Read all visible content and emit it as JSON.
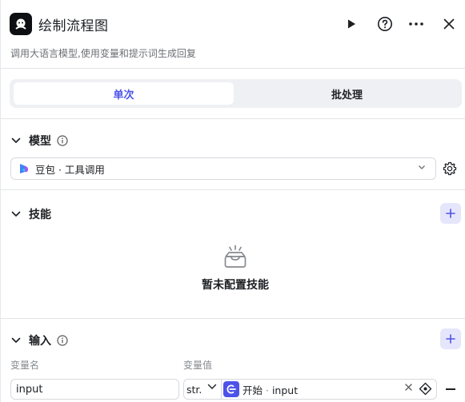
{
  "header": {
    "title": "绘制流程图",
    "subtitle": "调用大语言模型,使用变量和提示词生成回复",
    "icons": [
      "app-logo-icon",
      "play-icon",
      "help-icon",
      "more-icon",
      "close-icon"
    ]
  },
  "tabs": [
    {
      "label": "单次",
      "active": true
    },
    {
      "label": "批处理",
      "active": false
    }
  ],
  "model": {
    "section_title": "模型",
    "selected": "豆包 · 工具调用",
    "icons": [
      "info-icon",
      "doubao-logo-icon",
      "chevron-down-icon",
      "gear-icon"
    ]
  },
  "skills": {
    "section_title": "技能",
    "empty_text": "暂未配置技能",
    "icons": [
      "plus-icon",
      "empty-box-icon"
    ]
  },
  "input": {
    "section_title": "输入",
    "col_name_label": "变量名",
    "col_value_label": "变量值",
    "rows": [
      {
        "name": "input",
        "type": "str.",
        "ref_node": "开始",
        "ref_sep": " · ",
        "ref_var": "input"
      }
    ],
    "icons": [
      "info-icon",
      "plus-icon",
      "variable-ref-icon",
      "clear-icon",
      "minus-icon"
    ]
  },
  "colors": {
    "accent": "#4d53e8",
    "accent_light": "#e5e6fb",
    "tab_bg": "#eff0f3",
    "divider": "#e3e5e8",
    "text": "#1c1f23",
    "muted": "#6b7075"
  }
}
